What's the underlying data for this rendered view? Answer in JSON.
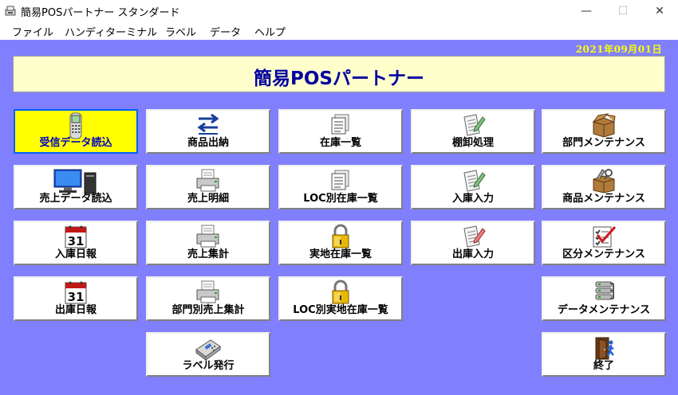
{
  "window": {
    "title": "簡易POSパートナー スタンダード",
    "controls": {
      "minimize": "—",
      "maximize": "☐",
      "close": "✕"
    }
  },
  "menu": [
    {
      "label": "ファイル"
    },
    {
      "label": "ハンディターミナル"
    },
    {
      "label": "ラベル"
    },
    {
      "label": "データ"
    },
    {
      "label": "ヘルプ"
    }
  ],
  "date": "2021年09月01日",
  "banner": {
    "title": "簡易POSパートナー"
  },
  "colors": {
    "background": "#8080ff",
    "banner": "#ffffcc",
    "banner_text": "#0000a0",
    "date_text": "#ffff00",
    "active_tile": "#ffff00"
  },
  "buttons": {
    "receive_data_import": {
      "label": "受信データ読込",
      "icon": "handheld-terminal-icon",
      "selected": true
    },
    "product_inout": {
      "label": "商品出納",
      "icon": "transfer-arrows-icon"
    },
    "stock_list": {
      "label": "在庫一覧",
      "icon": "documents-icon"
    },
    "inventory_process": {
      "label": "棚卸処理",
      "icon": "checklist-pencil-icon"
    },
    "department_maintenance": {
      "label": "部門メンテナンス",
      "icon": "box-icon"
    },
    "sales_data_import": {
      "label": "売上データ読込",
      "icon": "computer-icon"
    },
    "sales_detail": {
      "label": "売上明細",
      "icon": "printer-icon"
    },
    "loc_stock_list": {
      "label": "LOC別在庫一覧",
      "icon": "documents-icon"
    },
    "stock_in_entry": {
      "label": "入庫入力",
      "icon": "checklist-pencil-icon"
    },
    "product_maintenance": {
      "label": "商品メンテナンス",
      "icon": "tools-box-icon"
    },
    "stock_in_daily": {
      "label": "入庫日報",
      "icon": "calendar-icon",
      "icon_text": "31"
    },
    "sales_total": {
      "label": "売上集計",
      "icon": "printer-icon"
    },
    "actual_stock_list": {
      "label": "実地在庫一覧",
      "icon": "lock-icon"
    },
    "stock_out_entry": {
      "label": "出庫入力",
      "icon": "checklist-pencil-icon"
    },
    "category_maintenance": {
      "label": "区分メンテナンス",
      "icon": "checklist-icon"
    },
    "stock_out_daily": {
      "label": "出庫日報",
      "icon": "calendar-icon",
      "icon_text": "31"
    },
    "dept_sales_total": {
      "label": "部門別売上集計",
      "icon": "printer-icon"
    },
    "loc_actual_stock_list": {
      "label": "LOC別実地在庫一覧",
      "icon": "lock-icon"
    },
    "data_maintenance": {
      "label": "データメンテナンス",
      "icon": "database-icon"
    },
    "label_issue": {
      "label": "ラベル発行",
      "icon": "label-printer-icon"
    },
    "exit": {
      "label": "終了",
      "icon": "exit-door-icon"
    }
  }
}
